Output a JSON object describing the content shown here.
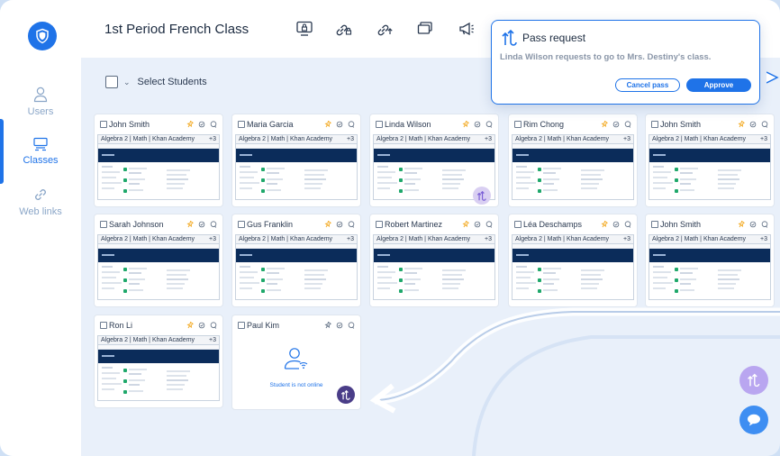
{
  "sidebar": {
    "logo": "shield-logo-icon",
    "items": [
      {
        "label": "Users",
        "icon": "user-icon",
        "active": false
      },
      {
        "label": "Classes",
        "icon": "classes-icon",
        "active": true
      },
      {
        "label": "Web links",
        "icon": "link-icon",
        "active": false
      }
    ]
  },
  "header": {
    "class_title": "1st Period French Class",
    "tools": [
      "lock-screen-icon",
      "lock-tab-icon",
      "open-tab-icon",
      "screen-share-icon",
      "announce-icon"
    ]
  },
  "selection": {
    "label": "Select Students"
  },
  "students": [
    {
      "name": "John Smith",
      "tab_title": "Algebra 2 | Math | Khan Academy",
      "tab_count": "+3",
      "online": true,
      "pass": false
    },
    {
      "name": "Maria Garcia",
      "tab_title": "Algebra 2 | Math | Khan Academy",
      "tab_count": "+3",
      "online": true,
      "pass": false
    },
    {
      "name": "Linda Wilson",
      "tab_title": "Algebra 2 | Math | Khan Academy",
      "tab_count": "+3",
      "online": true,
      "pass": true
    },
    {
      "name": "Rim Chong",
      "tab_title": "Algebra 2 | Math | Khan Academy",
      "tab_count": "+3",
      "online": true,
      "pass": false
    },
    {
      "name": "John Smith",
      "tab_title": "Algebra 2 | Math | Khan Academy",
      "tab_count": "+3",
      "online": true,
      "pass": false
    },
    {
      "name": "Sarah Johnson",
      "tab_title": "Algebra 2 | Math | Khan Academy",
      "tab_count": "+3",
      "online": true,
      "pass": false
    },
    {
      "name": "Gus Franklin",
      "tab_title": "Algebra 2 | Math | Khan Academy",
      "tab_count": "+3",
      "online": true,
      "pass": false
    },
    {
      "name": "Robert Martinez",
      "tab_title": "Algebra 2 | Math | Khan Academy",
      "tab_count": "+3",
      "online": true,
      "pass": false
    },
    {
      "name": "Léa Deschamps",
      "tab_title": "Algebra 2 | Math | Khan Academy",
      "tab_count": "+3",
      "online": true,
      "pass": false
    },
    {
      "name": "John Smith",
      "tab_title": "Algebra 2 | Math | Khan Academy",
      "tab_count": "+3",
      "online": true,
      "pass": false
    },
    {
      "name": "Ron Li",
      "tab_title": "Algebra 2 | Math | Khan Academy",
      "tab_count": "+3",
      "online": true,
      "pass": false
    },
    {
      "name": "Paul Kim",
      "offline_text": "Student is not online",
      "online": false,
      "pass": true
    }
  ],
  "pass_request": {
    "title": "Pass request",
    "message": "Linda Wilson requests to go to Mrs. Destiny's class.",
    "cancel_label": "Cancel pass",
    "approve_label": "Approve"
  },
  "colors": {
    "accent": "#1f73e8",
    "page_bg": "#e9f0fa",
    "banner": "#0b2c5a",
    "pin": "#f2a515",
    "pass_light": "#d9cff2",
    "pass_dark": "#4a3d88"
  },
  "fabs": [
    "pass-requests-icon",
    "chat-icon"
  ]
}
